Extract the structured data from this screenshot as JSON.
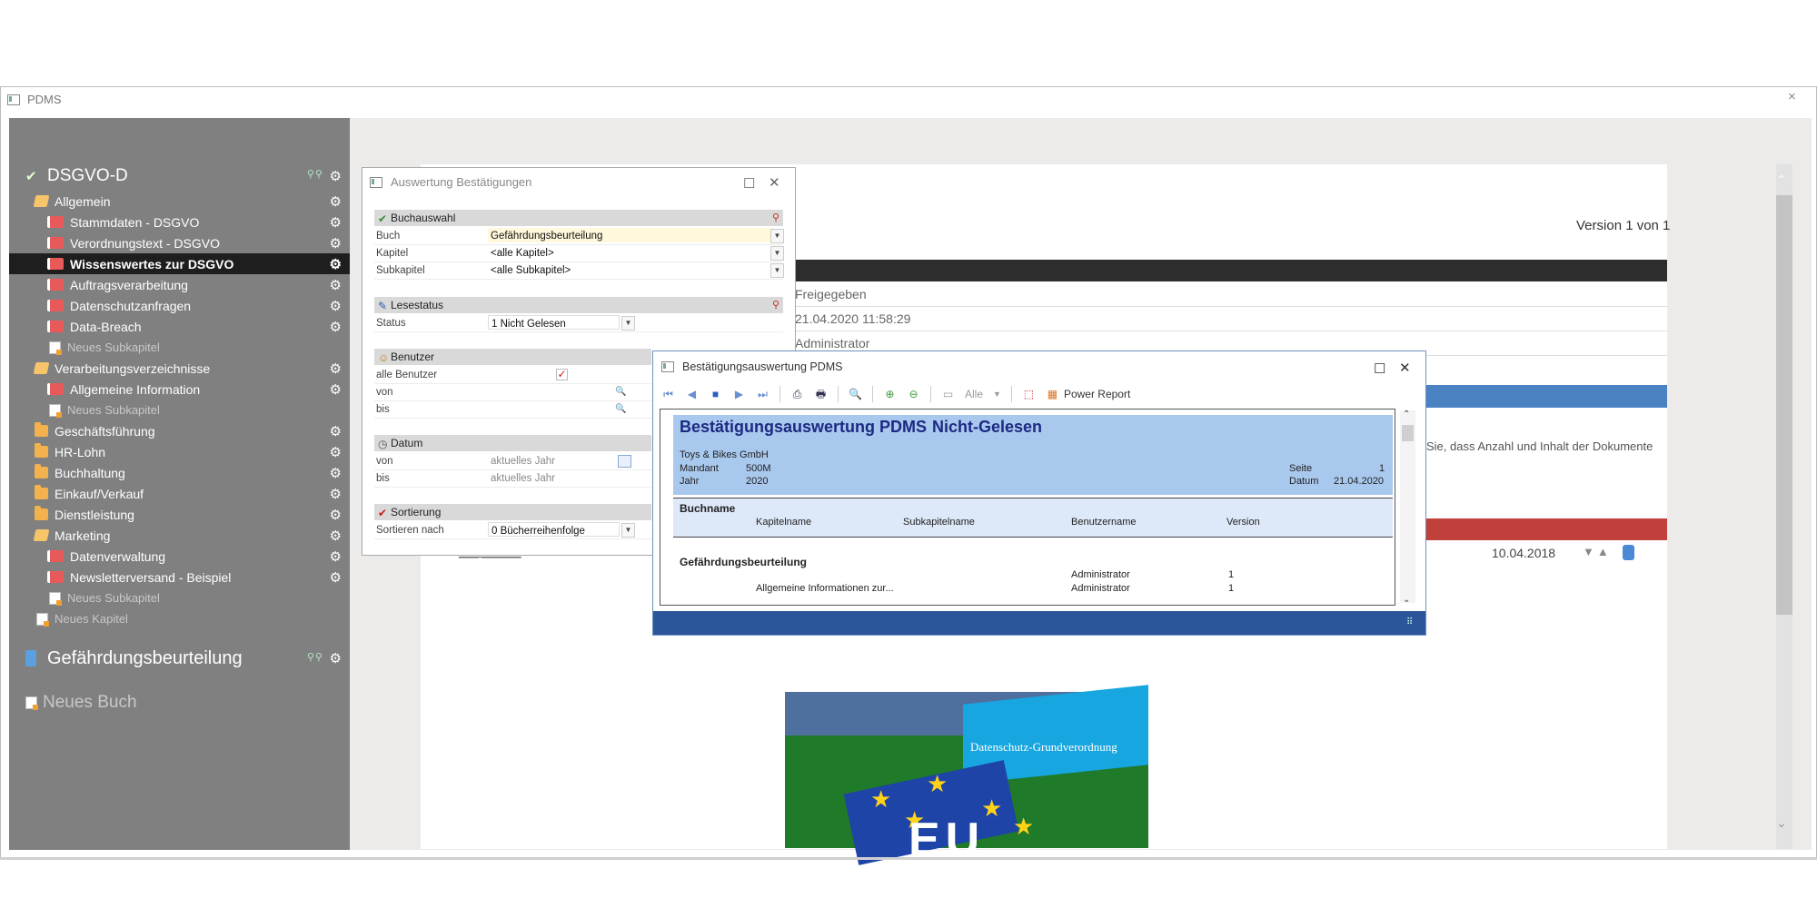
{
  "window": {
    "title": "PDMS",
    "close": "×"
  },
  "sidebar": {
    "book1": {
      "label": "DSGVO-D",
      "pins": "⚲⚲",
      "gear": "⚙"
    },
    "items": [
      {
        "label": "Allgemein"
      },
      {
        "label": "Stammdaten - DSGVO"
      },
      {
        "label": "Verordnungstext - DSGVO"
      },
      {
        "label": "Wissenswertes zur DSGVO"
      },
      {
        "label": "Auftragsverarbeitung"
      },
      {
        "label": "Datenschutzanfragen"
      },
      {
        "label": "Data-Breach"
      },
      {
        "label": "Neues Subkapitel"
      },
      {
        "label": "Verarbeitungsverzeichnisse"
      },
      {
        "label": "Allgemeine Information"
      },
      {
        "label": "Neues Subkapitel"
      },
      {
        "label": "Geschäftsführung"
      },
      {
        "label": "HR-Lohn"
      },
      {
        "label": "Buchhaltung"
      },
      {
        "label": "Einkauf/Verkauf"
      },
      {
        "label": "Dienstleistung"
      },
      {
        "label": "Marketing"
      },
      {
        "label": "Datenverwaltung"
      },
      {
        "label": "Newsletterversand - Beispiel"
      },
      {
        "label": "Neues Subkapitel"
      },
      {
        "label": "Neues Kapitel"
      }
    ],
    "book2": {
      "label": "Gefährdungsbeurteilung"
    },
    "new_book": {
      "label": "Neues Buch"
    }
  },
  "main": {
    "version": "Version 1 von 1",
    "status": "Freigegeben",
    "datetime": "21.04.2020 11:58:29",
    "user": "Administrator",
    "note": "Sie, dass Anzahl und Inhalt der Dokumente",
    "doc_date": "10.04.2018",
    "image_caption": "Datenschutz-Grundverordnung",
    "image_eu": "EU"
  },
  "dialog1": {
    "title": "Auswertung Bestätigungen",
    "sections": {
      "buchauswahl": "Buchauswahl",
      "lesestatus": "Lesestatus",
      "benutzer": "Benutzer",
      "datum": "Datum",
      "sortierung": "Sortierung"
    },
    "fields": {
      "buch": {
        "label": "Buch",
        "value": "Gefährdungsbeurteilung"
      },
      "kapitel": {
        "label": "Kapitel",
        "value": "<alle Kapitel>"
      },
      "subkapitel": {
        "label": "Subkapitel",
        "value": "<alle Subkapitel>"
      },
      "status": {
        "label": "Status",
        "value": "1 Nicht Gelesen"
      },
      "alle_benutzer": {
        "label": "alle Benutzer",
        "checked": "✓"
      },
      "benutzer_von": {
        "label": "von"
      },
      "benutzer_bis": {
        "label": "bis"
      },
      "datum_von": {
        "label": "von",
        "value": "aktuelles Jahr"
      },
      "datum_bis": {
        "label": "bis",
        "value": "aktuelles Jahr"
      },
      "sortieren": {
        "label": "Sortieren nach",
        "value": "0 Bücherreihenfolge"
      }
    }
  },
  "dialog2": {
    "title": "Bestätigungsauswertung PDMS",
    "toolbar": {
      "alle": "Alle",
      "power_report": "Power Report"
    },
    "report": {
      "title": "Bestätigungsauswertung PDMS",
      "status": "Nicht-Gelesen",
      "company": "Toys & Bikes GmbH",
      "mandant_label": "Mandant",
      "mandant_value": "500M",
      "jahr_label": "Jahr",
      "jahr_value": "2020",
      "seite_label": "Seite",
      "seite_value": "1",
      "datum_label": "Datum",
      "datum_value": "21.04.2020",
      "columns": {
        "buchname": "Buchname",
        "kapitelname": "Kapitelname",
        "subkapitelname": "Subkapitelname",
        "benutzername": "Benutzername",
        "version": "Version"
      },
      "group": "Gefährdungsbeurteilung",
      "rows": [
        {
          "kapitel": "",
          "benutzer": "Administrator",
          "version": "1"
        },
        {
          "kapitel": "Allgemeine Informationen zur...",
          "benutzer": "Administrator",
          "version": "1"
        }
      ]
    }
  },
  "colors": {
    "sidebar": "#808080",
    "selected": "#1e1e1e",
    "accent_blue": "#2b579a",
    "report_header": "#a9c8ee",
    "red_bar": "#c0413b"
  }
}
